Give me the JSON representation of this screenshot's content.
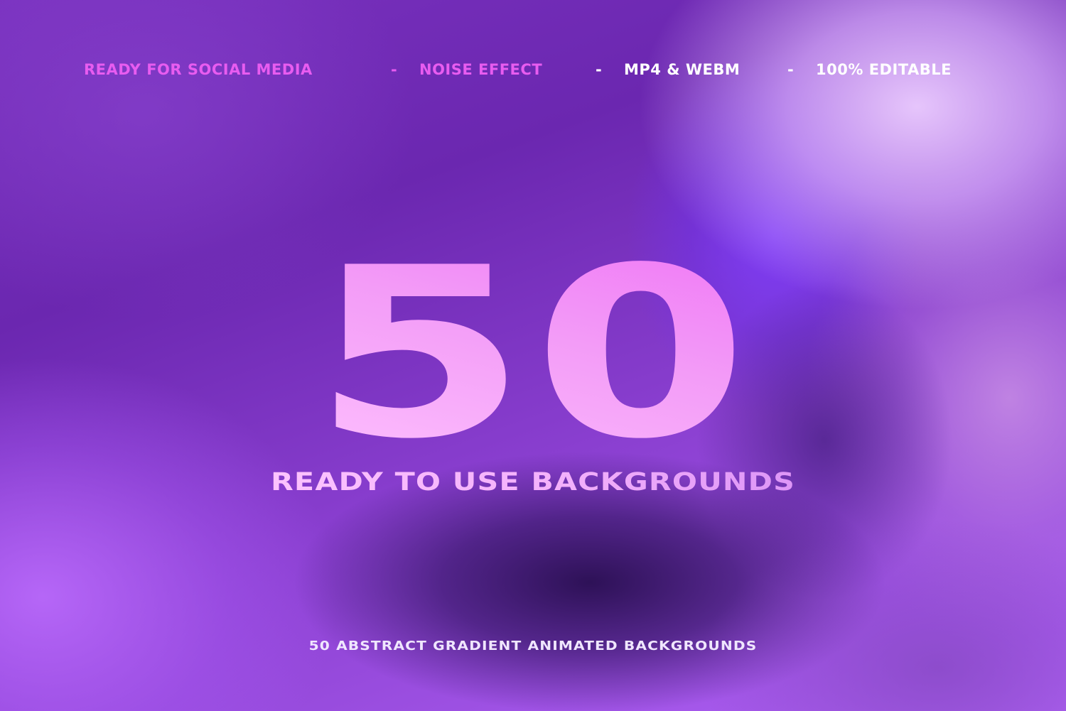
{
  "features": {
    "items": [
      "READY FOR SOCIAL MEDIA",
      "NOISE EFFECT",
      "MP4 & WEBM",
      "100% EDITABLE"
    ],
    "separator": "-"
  },
  "hero": {
    "number": "50",
    "subtitle": "READY TO USE BACKGROUNDS"
  },
  "footer": {
    "text": "50 ABSTRACT GRADIENT ANIMATED BACKGROUNDS"
  },
  "colors": {
    "feature_pink": "#e85cf0",
    "feature_white": "#ffffff",
    "footer_text": "#f0e6ff",
    "hero_gradient_start": "#ef6cf6",
    "hero_gradient_end": "#ffc7ff"
  }
}
